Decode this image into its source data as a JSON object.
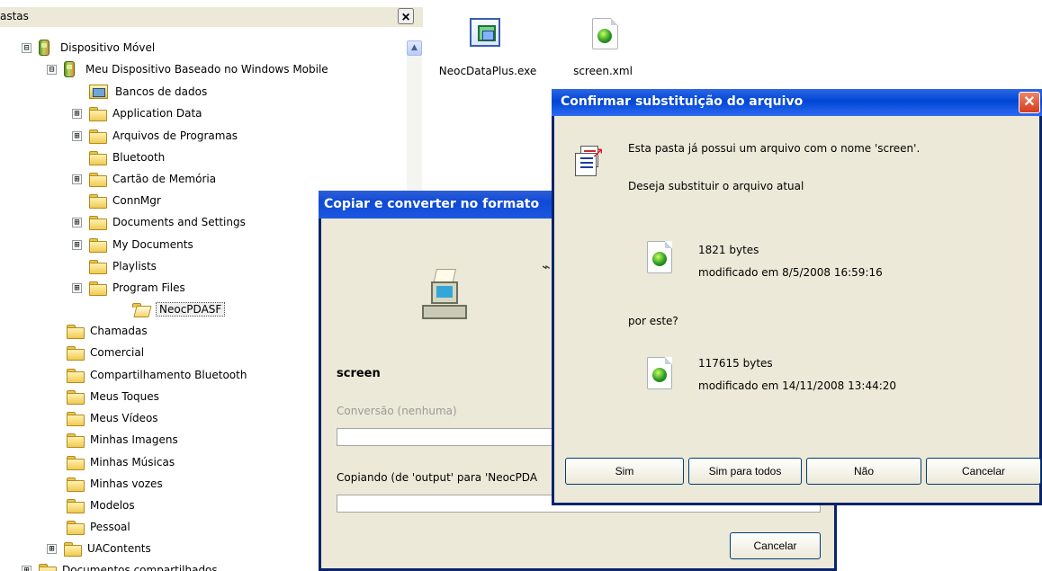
{
  "tree_pane": {
    "title": "astas",
    "close_label": "×",
    "items": [
      {
        "label": "Dispositivo Móvel",
        "expander": "⊟",
        "icon": "mobile-device-icon"
      },
      {
        "label": "Meu Dispositivo Baseado no Windows Mobile",
        "expander": "⊟",
        "icon": "mobile-device-icon"
      },
      {
        "label": "Bancos de dados",
        "expander": "",
        "icon": "database-icon"
      },
      {
        "label": "Application Data",
        "expander": "⊞",
        "icon": "folder-icon"
      },
      {
        "label": "Arquivos de Programas",
        "expander": "⊞",
        "icon": "folder-icon"
      },
      {
        "label": "Bluetooth",
        "expander": "",
        "icon": "folder-icon"
      },
      {
        "label": "Cartão de Memória",
        "expander": "⊞",
        "icon": "folder-icon"
      },
      {
        "label": "ConnMgr",
        "expander": "",
        "icon": "folder-icon"
      },
      {
        "label": "Documents and Settings",
        "expander": "⊞",
        "icon": "folder-icon"
      },
      {
        "label": "My Documents",
        "expander": "⊞",
        "icon": "folder-icon"
      },
      {
        "label": "Playlists",
        "expander": "",
        "icon": "folder-icon"
      },
      {
        "label": "Program Files",
        "expander": "⊞",
        "icon": "folder-icon"
      },
      {
        "label": "NeocPDASF",
        "expander": "",
        "icon": "open-folder-icon",
        "selected": true
      },
      {
        "label": "Chamadas",
        "expander": "",
        "icon": "folder-icon"
      },
      {
        "label": "Comercial",
        "expander": "",
        "icon": "folder-icon"
      },
      {
        "label": "Compartilhamento Bluetooth",
        "expander": "",
        "icon": "folder-icon"
      },
      {
        "label": "Meus Toques",
        "expander": "",
        "icon": "folder-icon"
      },
      {
        "label": "Meus Vídeos",
        "expander": "",
        "icon": "folder-icon"
      },
      {
        "label": "Minhas Imagens",
        "expander": "",
        "icon": "folder-icon"
      },
      {
        "label": "Minhas Músicas",
        "expander": "",
        "icon": "folder-icon"
      },
      {
        "label": "Minhas vozes",
        "expander": "",
        "icon": "folder-icon"
      },
      {
        "label": "Modelos",
        "expander": "",
        "icon": "folder-icon"
      },
      {
        "label": "Pessoal",
        "expander": "",
        "icon": "folder-icon"
      },
      {
        "label": "UAContents",
        "expander": "⊞",
        "icon": "folder-icon"
      },
      {
        "label": "Documentos compartilhados",
        "expander": "⊞",
        "icon": "folder-icon"
      }
    ]
  },
  "desktop_files": [
    {
      "name": "NeocDataPlus.exe",
      "icon": "executable-icon"
    },
    {
      "name": "screen.xml",
      "icon": "xml-file-icon"
    }
  ],
  "copy_dialog": {
    "title": "Copiar e converter no formato",
    "filename": "screen",
    "conversion": "Conversão (nenhuma)",
    "status": "Copiando (de 'output' para 'NeocPDA",
    "cancel_label": "Cancelar"
  },
  "confirm_dialog": {
    "title": "Confirmar substituição do arquivo",
    "message": "Esta pasta já possui um arquivo  com o nome 'screen'.",
    "question": "Deseja substituir o arquivo atual",
    "existing_size": "1821 bytes",
    "existing_modified": "modificado em 8/5/2008  16:59:16",
    "replace_with": "por este?",
    "new_size": "117615 bytes",
    "new_modified": "modificado em 14/11/2008  13:44:20",
    "buttons": {
      "yes": "Sim",
      "yes_all": "Sim para todos",
      "no": "Não",
      "cancel": "Cancelar"
    },
    "close_label": "✕"
  }
}
